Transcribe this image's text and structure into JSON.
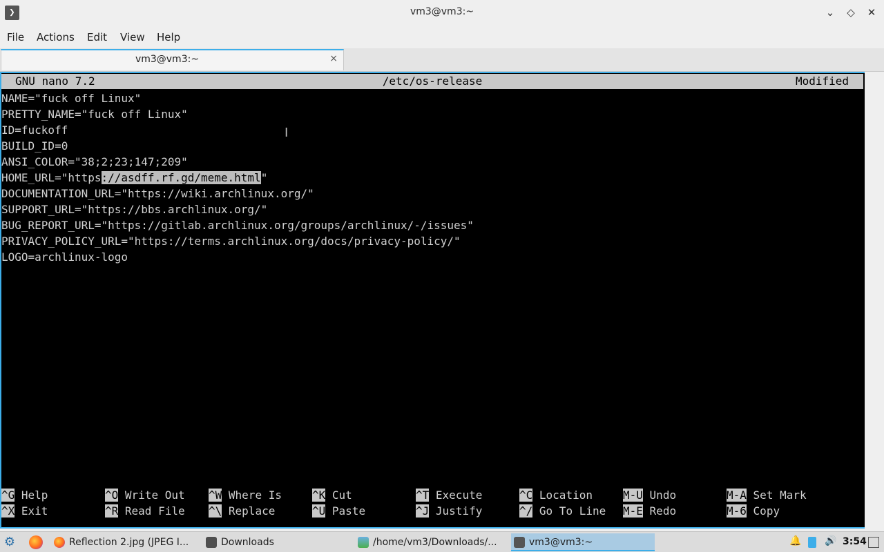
{
  "window": {
    "title": "vm3@vm3:~"
  },
  "menubar": {
    "items": [
      "File",
      "Actions",
      "Edit",
      "View",
      "Help"
    ]
  },
  "tab": {
    "label": "vm3@vm3:~",
    "close_glyph": "×"
  },
  "nano": {
    "version": "GNU nano 7.2",
    "filename": "/etc/os-release",
    "status": "Modified",
    "lines": [
      {
        "text": "NAME=\"fuck off Linux\""
      },
      {
        "text": "PRETTY_NAME=\"fuck off Linux\""
      },
      {
        "text": "ID=fuckoff"
      },
      {
        "text": "BUILD_ID=0"
      },
      {
        "text": "ANSI_COLOR=\"38;2;23;147;209\""
      },
      {
        "text": "HOME_URL=\"https",
        "selected": "://asdff.rf.gd/meme.html",
        "after": "\""
      },
      {
        "text": "DOCUMENTATION_URL=\"https://wiki.archlinux.org/\""
      },
      {
        "text": "SUPPORT_URL=\"https://bbs.archlinux.org/\""
      },
      {
        "text": "BUG_REPORT_URL=\"https://gitlab.archlinux.org/groups/archlinux/-/issues\""
      },
      {
        "text": "PRIVACY_POLICY_URL=\"https://terms.archlinux.org/docs/privacy-policy/\""
      },
      {
        "text": "LOGO=archlinux-logo"
      }
    ],
    "shortcuts_row1": [
      {
        "key": "^G",
        "label": "Help"
      },
      {
        "key": "^O",
        "label": "Write Out"
      },
      {
        "key": "^W",
        "label": "Where Is"
      },
      {
        "key": "^K",
        "label": "Cut"
      },
      {
        "key": "^T",
        "label": "Execute"
      },
      {
        "key": "^C",
        "label": "Location"
      },
      {
        "key": "M-U",
        "label": "Undo"
      },
      {
        "key": "M-A",
        "label": "Set Mark"
      }
    ],
    "shortcuts_row2": [
      {
        "key": "^X",
        "label": "Exit"
      },
      {
        "key": "^R",
        "label": "Read File"
      },
      {
        "key": "^\\",
        "label": "Replace"
      },
      {
        "key": "^U",
        "label": "Paste"
      },
      {
        "key": "^J",
        "label": "Justify"
      },
      {
        "key": "^/",
        "label": "Go To Line"
      },
      {
        "key": "M-E",
        "label": "Redo"
      },
      {
        "key": "M-6",
        "label": "Copy"
      }
    ]
  },
  "taskbar": {
    "tasks": [
      {
        "label": "Reflection 2.jpg (JPEG I...",
        "icon": "firefox-icon"
      },
      {
        "label": "Downloads",
        "icon": "folder-icon"
      },
      {
        "label": "/home/vm3/Downloads/...",
        "icon": "image-viewer-icon"
      },
      {
        "label": "vm3@vm3:~",
        "icon": "terminal-icon",
        "active": true
      }
    ],
    "clock": "3:54"
  },
  "colors": {
    "accent": "#3daee9",
    "terminal_bg": "#000000",
    "terminal_fg": "#d0d0d0",
    "nano_bar": "#c8c8c8"
  }
}
